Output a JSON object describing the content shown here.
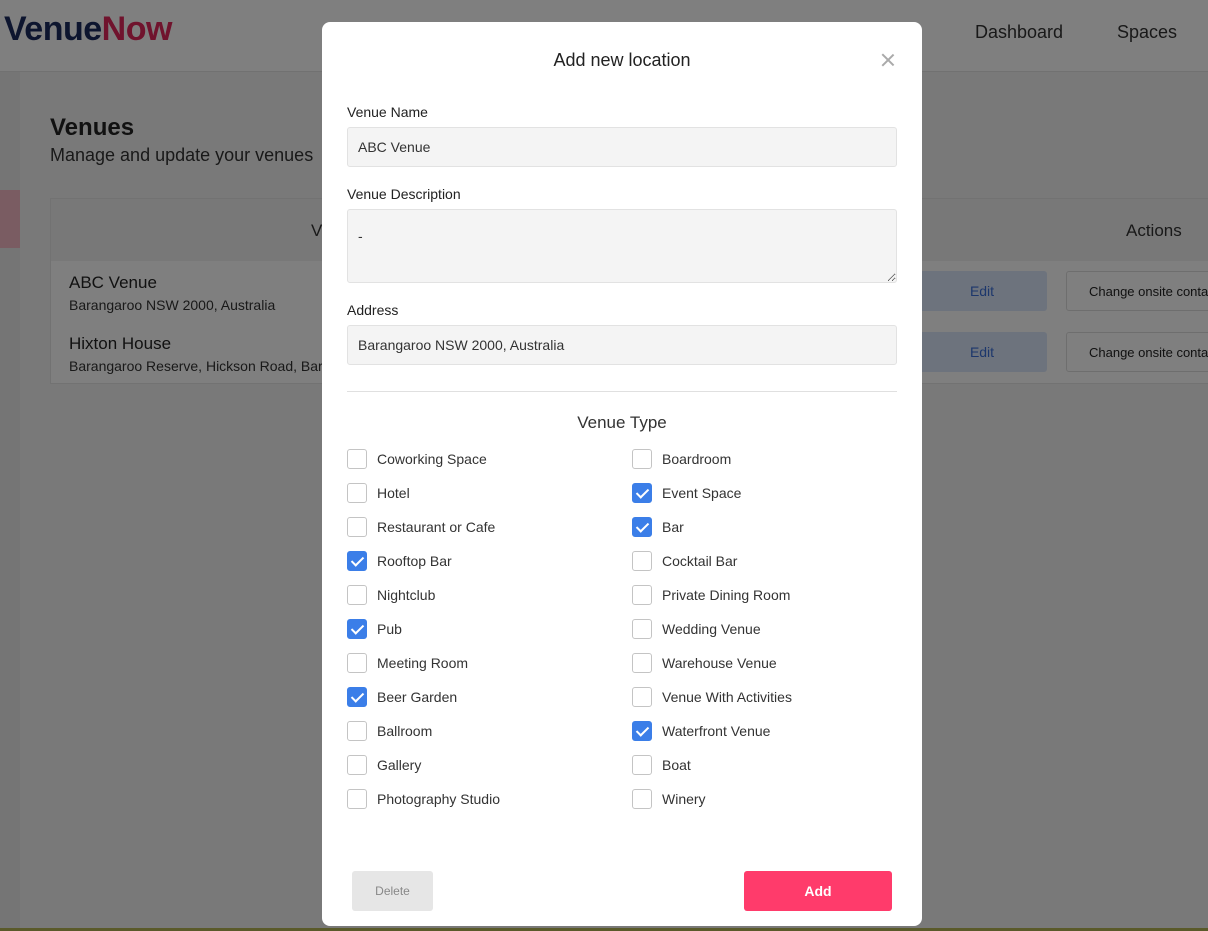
{
  "brand": {
    "part1": "Venue",
    "part2": "Now",
    "color1": "#1b2a5e",
    "color2": "#e0265a"
  },
  "nav": {
    "dashboard": "Dashboard",
    "spaces": "Spaces"
  },
  "page": {
    "title": "Venues",
    "subtitle": "Manage and update your venues"
  },
  "table": {
    "columns": {
      "venue": "V",
      "actions": "Actions"
    },
    "rows": [
      {
        "name": "ABC Venue",
        "address": "Barangaroo NSW 2000, Australia",
        "edit": "Edit",
        "contact": "Change onsite contact"
      },
      {
        "name": "Hixton House",
        "address": "Barangaroo Reserve, Hickson Road, Barangaroo",
        "edit": "Edit",
        "contact": "Change onsite contact"
      }
    ]
  },
  "modal": {
    "title": "Add new location",
    "venue_name": {
      "label": "Venue Name",
      "value": "ABC Venue"
    },
    "venue_description": {
      "label": "Venue Description",
      "value": "-"
    },
    "address": {
      "label": "Address",
      "value": "Barangaroo NSW 2000, Australia"
    },
    "venue_type_title": "Venue Type",
    "venue_types_left": [
      {
        "label": "Coworking Space",
        "checked": false
      },
      {
        "label": "Hotel",
        "checked": false
      },
      {
        "label": "Restaurant or Cafe",
        "checked": false
      },
      {
        "label": "Rooftop Bar",
        "checked": true
      },
      {
        "label": "Nightclub",
        "checked": false
      },
      {
        "label": "Pub",
        "checked": true
      },
      {
        "label": "Meeting Room",
        "checked": false
      },
      {
        "label": "Beer Garden",
        "checked": true
      },
      {
        "label": "Ballroom",
        "checked": false
      },
      {
        "label": "Gallery",
        "checked": false
      },
      {
        "label": "Photography Studio",
        "checked": false
      }
    ],
    "venue_types_right": [
      {
        "label": "Boardroom",
        "checked": false
      },
      {
        "label": "Event Space",
        "checked": true
      },
      {
        "label": "Bar",
        "checked": true
      },
      {
        "label": "Cocktail Bar",
        "checked": false
      },
      {
        "label": "Private Dining Room",
        "checked": false
      },
      {
        "label": "Wedding Venue",
        "checked": false
      },
      {
        "label": "Warehouse Venue",
        "checked": false
      },
      {
        "label": "Venue With Activities",
        "checked": false
      },
      {
        "label": "Waterfront Venue",
        "checked": true
      },
      {
        "label": "Boat",
        "checked": false
      },
      {
        "label": "Winery",
        "checked": false
      }
    ],
    "delete_label": "Delete",
    "add_label": "Add",
    "accent_color": "#ff3b6b",
    "checkbox_color": "#3b7ee8"
  }
}
